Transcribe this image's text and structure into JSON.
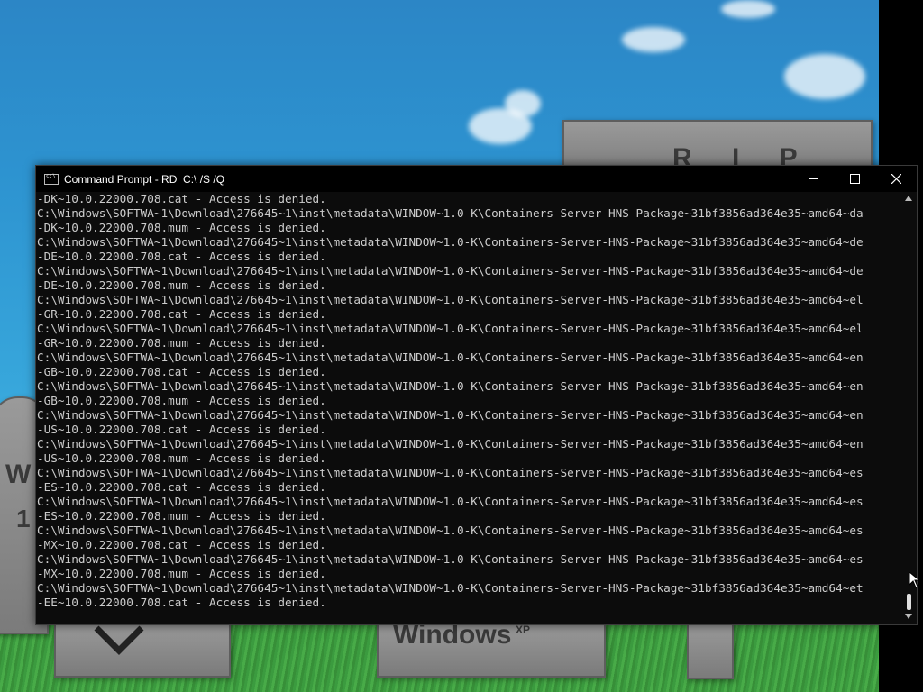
{
  "window": {
    "title": "Command Prompt - RD  C:\\ /S /Q",
    "minimize_icon": "minimize-icon",
    "maximize_icon": "maximize-icon",
    "close_icon": "close-icon"
  },
  "desktop": {
    "tombstone_top_text": "R I P",
    "tombstone_windows_text": "Windows",
    "tombstone_windows_sup": "XP",
    "tombstone_left_text": "W",
    "tombstone_left_num": "1"
  },
  "console": {
    "lines": [
      "-DK~10.0.22000.708.cat - Access is denied.",
      "C:\\Windows\\SOFTWA~1\\Download\\276645~1\\inst\\metadata\\WINDOW~1.0-K\\Containers-Server-HNS-Package~31bf3856ad364e35~amd64~da",
      "-DK~10.0.22000.708.mum - Access is denied.",
      "C:\\Windows\\SOFTWA~1\\Download\\276645~1\\inst\\metadata\\WINDOW~1.0-K\\Containers-Server-HNS-Package~31bf3856ad364e35~amd64~de",
      "-DE~10.0.22000.708.cat - Access is denied.",
      "C:\\Windows\\SOFTWA~1\\Download\\276645~1\\inst\\metadata\\WINDOW~1.0-K\\Containers-Server-HNS-Package~31bf3856ad364e35~amd64~de",
      "-DE~10.0.22000.708.mum - Access is denied.",
      "C:\\Windows\\SOFTWA~1\\Download\\276645~1\\inst\\metadata\\WINDOW~1.0-K\\Containers-Server-HNS-Package~31bf3856ad364e35~amd64~el",
      "-GR~10.0.22000.708.cat - Access is denied.",
      "C:\\Windows\\SOFTWA~1\\Download\\276645~1\\inst\\metadata\\WINDOW~1.0-K\\Containers-Server-HNS-Package~31bf3856ad364e35~amd64~el",
      "-GR~10.0.22000.708.mum - Access is denied.",
      "C:\\Windows\\SOFTWA~1\\Download\\276645~1\\inst\\metadata\\WINDOW~1.0-K\\Containers-Server-HNS-Package~31bf3856ad364e35~amd64~en",
      "-GB~10.0.22000.708.cat - Access is denied.",
      "C:\\Windows\\SOFTWA~1\\Download\\276645~1\\inst\\metadata\\WINDOW~1.0-K\\Containers-Server-HNS-Package~31bf3856ad364e35~amd64~en",
      "-GB~10.0.22000.708.mum - Access is denied.",
      "C:\\Windows\\SOFTWA~1\\Download\\276645~1\\inst\\metadata\\WINDOW~1.0-K\\Containers-Server-HNS-Package~31bf3856ad364e35~amd64~en",
      "-US~10.0.22000.708.cat - Access is denied.",
      "C:\\Windows\\SOFTWA~1\\Download\\276645~1\\inst\\metadata\\WINDOW~1.0-K\\Containers-Server-HNS-Package~31bf3856ad364e35~amd64~en",
      "-US~10.0.22000.708.mum - Access is denied.",
      "C:\\Windows\\SOFTWA~1\\Download\\276645~1\\inst\\metadata\\WINDOW~1.0-K\\Containers-Server-HNS-Package~31bf3856ad364e35~amd64~es",
      "-ES~10.0.22000.708.cat - Access is denied.",
      "C:\\Windows\\SOFTWA~1\\Download\\276645~1\\inst\\metadata\\WINDOW~1.0-K\\Containers-Server-HNS-Package~31bf3856ad364e35~amd64~es",
      "-ES~10.0.22000.708.mum - Access is denied.",
      "C:\\Windows\\SOFTWA~1\\Download\\276645~1\\inst\\metadata\\WINDOW~1.0-K\\Containers-Server-HNS-Package~31bf3856ad364e35~amd64~es",
      "-MX~10.0.22000.708.cat - Access is denied.",
      "C:\\Windows\\SOFTWA~1\\Download\\276645~1\\inst\\metadata\\WINDOW~1.0-K\\Containers-Server-HNS-Package~31bf3856ad364e35~amd64~es",
      "-MX~10.0.22000.708.mum - Access is denied.",
      "C:\\Windows\\SOFTWA~1\\Download\\276645~1\\inst\\metadata\\WINDOW~1.0-K\\Containers-Server-HNS-Package~31bf3856ad364e35~amd64~et",
      "-EE~10.0.22000.708.cat - Access is denied."
    ]
  },
  "colors": {
    "console_bg": "#0c0c0c",
    "console_text": "#cccccc",
    "titlebar_bg": "#000000"
  }
}
